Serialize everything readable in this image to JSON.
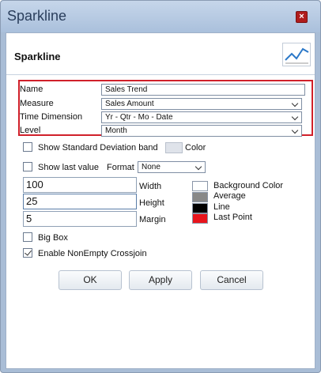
{
  "window": {
    "title": "Sparkline",
    "close_glyph": "×"
  },
  "header": {
    "title": "Sparkline",
    "icon": "sparkline-chart-icon"
  },
  "fields": {
    "name": {
      "label": "Name",
      "value": "Sales Trend"
    },
    "measure": {
      "label": "Measure",
      "value": "Sales Amount"
    },
    "time_dimension": {
      "label": "Time Dimension",
      "value": "Yr - Qtr - Mo - Date"
    },
    "level": {
      "label": "Level",
      "value": "Month"
    }
  },
  "options": {
    "show_std_dev": {
      "label": "Show Standard Deviation band",
      "checked": false,
      "color_label": "Color",
      "color": "#dfe3ea"
    },
    "show_last_value": {
      "label": "Show last value",
      "checked": false
    },
    "format": {
      "label": "Format",
      "value": "None"
    }
  },
  "dimensions": {
    "width": {
      "label": "Width",
      "value": "100"
    },
    "height": {
      "label": "Height",
      "value": "25"
    },
    "margin": {
      "label": "Margin",
      "value": "5"
    }
  },
  "colors": {
    "background": {
      "label": "Background Color",
      "color": "#ffffff"
    },
    "average": {
      "label": "Average",
      "color": "#888888"
    },
    "line": {
      "label": "Line",
      "color": "#000000"
    },
    "last_point": {
      "label": "Last Point",
      "color": "#e8141c"
    }
  },
  "flags": {
    "big_box": {
      "label": "Big Box",
      "checked": false
    },
    "nonempty": {
      "label": "Enable NonEmpty Crossjoin",
      "checked": true
    }
  },
  "buttons": {
    "ok": "OK",
    "apply": "Apply",
    "cancel": "Cancel"
  },
  "accent": {
    "highlight_border": "#d0202a",
    "title_text": "#2a3e5c"
  }
}
